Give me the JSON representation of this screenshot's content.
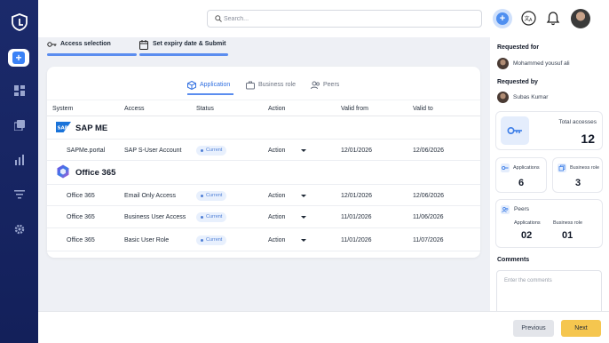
{
  "search": {
    "placeholder": "Search..."
  },
  "steps": [
    {
      "label": "Access selection"
    },
    {
      "label": "Set expiry date & Submit"
    }
  ],
  "tabs": [
    {
      "label": "Application",
      "active": true
    },
    {
      "label": "Business role",
      "active": false
    },
    {
      "label": "Peers",
      "active": false
    }
  ],
  "table": {
    "headers": [
      "System",
      "Access",
      "Status",
      "Action",
      "Valid from",
      "Valid to"
    ],
    "groups": [
      {
        "name": "SAP ME",
        "logo_text": "SAP",
        "rows": [
          {
            "system": "SAPMe.portal",
            "access": "SAP S-User Account",
            "status": "Current",
            "action": "Action",
            "valid_from": "12/01/2026",
            "valid_to": "12/06/2026"
          }
        ]
      },
      {
        "name": "Office 365",
        "rows": [
          {
            "system": "Office 365",
            "access": "Email Only Access",
            "status": "Current",
            "action": "Action",
            "valid_from": "12/01/2026",
            "valid_to": "12/06/2026"
          },
          {
            "system": "Office 365",
            "access": "Business User Access",
            "status": "Current",
            "action": "Action",
            "valid_from": "11/01/2026",
            "valid_to": "11/06/2026"
          },
          {
            "system": "Office 365",
            "access": "Basic User Role",
            "status": "Current",
            "action": "Action",
            "valid_from": "11/01/2026",
            "valid_to": "11/07/2026"
          }
        ]
      }
    ]
  },
  "right_panel": {
    "requested_for_label": "Requested for",
    "requested_for_name": "Mohammed yousuf ali",
    "requested_by_label": "Requested by",
    "requested_by_name": "Subas Kumar",
    "total_accesses_label": "Total accesses",
    "total_accesses_value": "12",
    "applications_label": "Applications",
    "applications_value": "6",
    "business_role_label": "Business role",
    "business_role_value": "3",
    "peers_label": "Peers",
    "peers_applications_label": "Applications",
    "peers_applications_value": "02",
    "peers_business_role_label": "Business role",
    "peers_business_role_value": "01",
    "comments_label": "Comments",
    "comments_placeholder": "Enter the comments"
  },
  "footer": {
    "previous_label": "Previous",
    "next_label": "Next"
  },
  "colors": {
    "sidebar": "#1b2a6b",
    "accent": "#5b8def",
    "next_button": "#f5c64f",
    "badge_bg": "#e8f0fd"
  },
  "icons": [
    "logo-icon",
    "add-icon",
    "dashboard-icon",
    "copy-icon",
    "chart-icon",
    "filter-icon",
    "settings-icon",
    "search-icon",
    "shield-icon",
    "translate-icon",
    "bell-icon",
    "key-icon",
    "calendar-icon",
    "cube-icon",
    "briefcase-icon",
    "users-icon"
  ]
}
